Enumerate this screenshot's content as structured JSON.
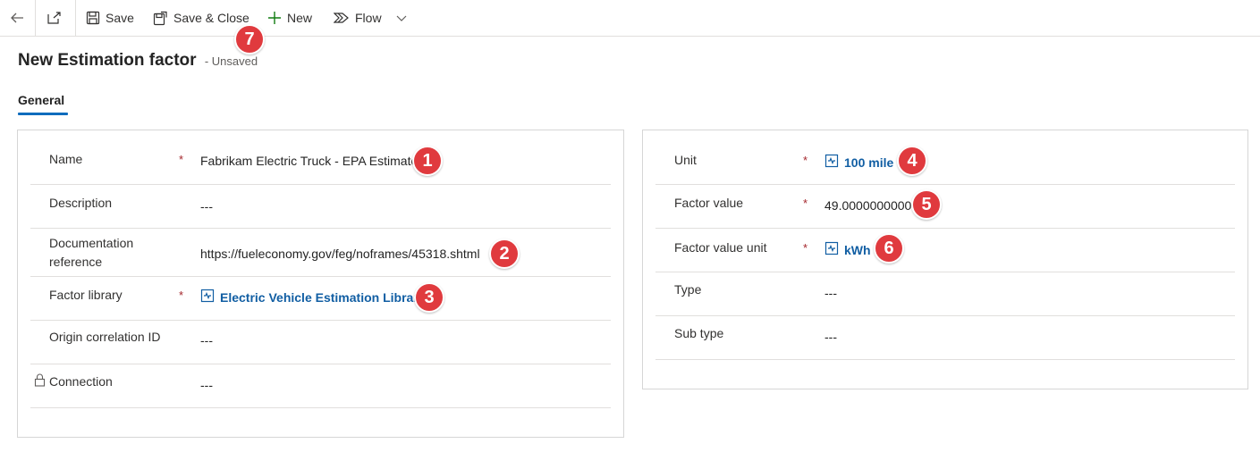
{
  "toolbar": {
    "save_label": "Save",
    "save_close_label": "Save & Close",
    "new_label": "New",
    "flow_label": "Flow"
  },
  "header": {
    "title": "New Estimation factor",
    "status": "- Unsaved",
    "tab_general": "General"
  },
  "left_section": {
    "name_label": "Name",
    "name_value": "Fabrikam Electric Truck - EPA Estimate",
    "description_label": "Description",
    "description_value": "---",
    "docref_label_line1": "Documentation",
    "docref_label_line2": "reference",
    "docref_value": "https://fueleconomy.gov/feg/noframes/45318.shtml",
    "factor_library_label": "Factor library",
    "factor_library_value": "Electric Vehicle Estimation Library",
    "origin_label": "Origin correlation ID",
    "origin_value": "---",
    "connection_label": "Connection",
    "connection_value": "---"
  },
  "right_section": {
    "unit_label": "Unit",
    "unit_value": "100 mile",
    "factor_value_label": "Factor value",
    "factor_value_value": "49.0000000000",
    "factor_value_unit_label": "Factor value unit",
    "factor_value_unit_value": "kWh",
    "type_label": "Type",
    "type_value": "---",
    "subtype_label": "Sub type",
    "subtype_value": "---"
  },
  "required_marker": "*",
  "badges": [
    "1",
    "2",
    "3",
    "4",
    "5",
    "6",
    "7"
  ],
  "colors": {
    "link": "#115ea3",
    "required": "#a4262c",
    "badge": "#e03a3e",
    "tab_accent": "#0f6cbd"
  }
}
